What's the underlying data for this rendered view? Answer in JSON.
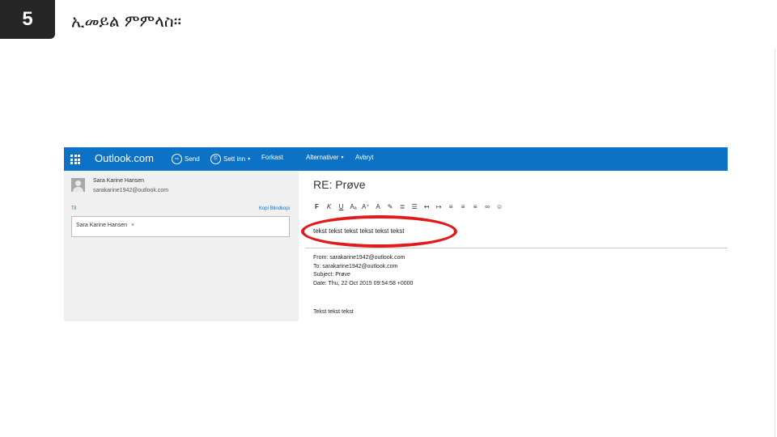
{
  "slide": {
    "step_number": "5",
    "title": "ኢመይል ምምላስ፡፡"
  },
  "outlook": {
    "brand": "Outlook.com",
    "toolbar": {
      "send_label": "Send",
      "attach_label": "Sett inn",
      "discard_label": "Forkast",
      "options_label": "Alternativer",
      "cancel_label": "Avbryt"
    },
    "sender": {
      "name": "Sara Karine Hansen",
      "email": "sarakarine1942@outlook.com"
    },
    "to_label": "Til",
    "cc_links": "Kopi  Blindkopi",
    "recipient_chip": "Sara Karine Hansen",
    "recipient_remove": "×",
    "subject": "RE: Prøve",
    "format_buttons": [
      "F",
      "K",
      "U",
      "Aₐ",
      "A⁺",
      "A",
      "✎",
      "≣",
      "☰",
      "↤",
      "↦",
      "≡",
      "≡",
      "≡",
      "∞",
      "☺"
    ],
    "body_text": "tekst tekst tekst tekst tekst tekst",
    "quoted": {
      "from": "From: sarakarine1942@outlook.com",
      "to": "To: sarakarine1942@outlook.com",
      "subject": "Subject: Prøve",
      "date": "Date: Thu, 22 Oct 2015 09:54:58 +0000"
    },
    "quoted_body": "Tekst tekst tekst"
  },
  "colors": {
    "outlook_blue": "#0b72c6",
    "highlight_red": "#e01b1b",
    "badge_dark": "#262626"
  }
}
